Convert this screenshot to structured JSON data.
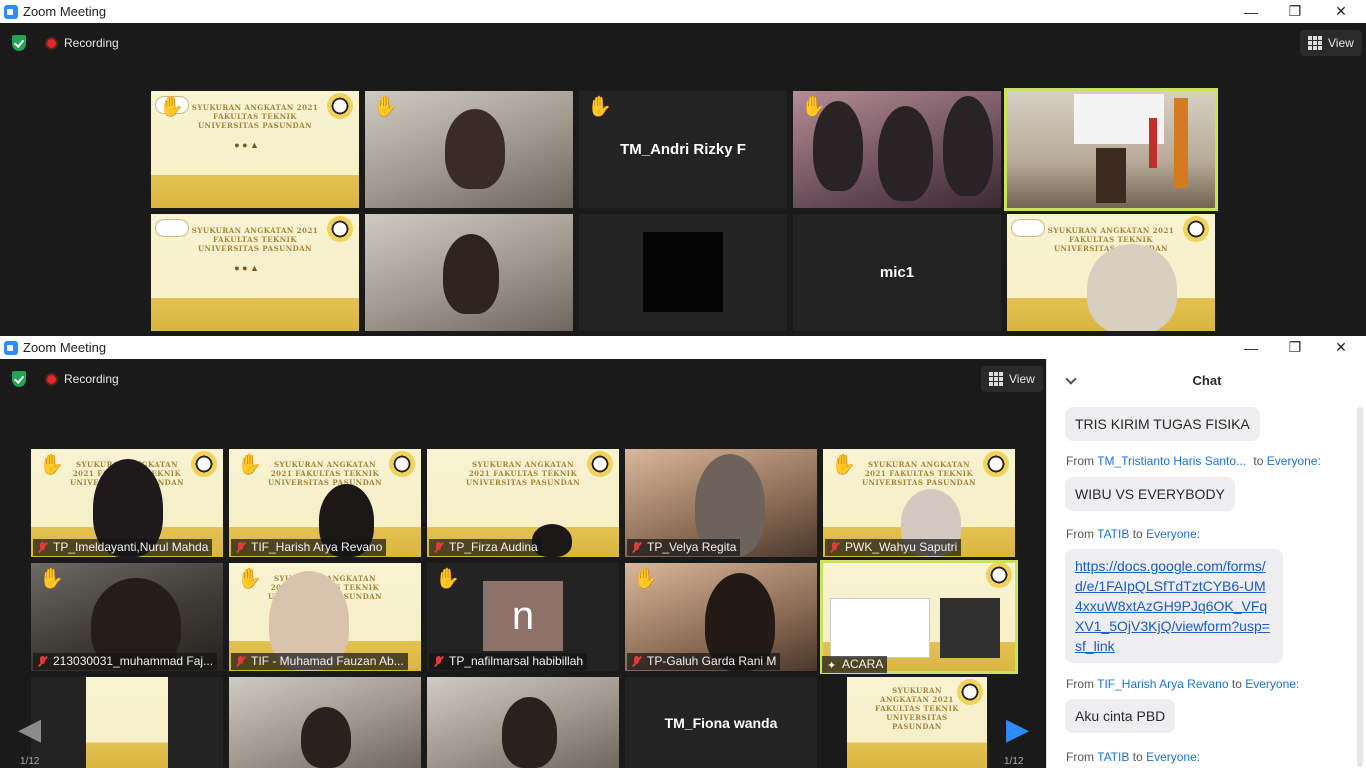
{
  "window1": {
    "title": "Zoom Meeting",
    "recording": "Recording",
    "view_label": "View",
    "controls": [
      "—",
      "❐",
      "✕"
    ],
    "tiles": [
      {
        "name": "",
        "hand": true
      },
      {
        "name": "",
        "hand": true
      },
      {
        "name": "TM_Andri Rizky F",
        "hand": true
      },
      {
        "name": "",
        "hand": true
      },
      {
        "name": "",
        "hand": false
      },
      {
        "name": "",
        "hand": false
      },
      {
        "name": "",
        "hand": false
      },
      {
        "name": "",
        "hand": false
      },
      {
        "name": "mic1",
        "hand": false
      },
      {
        "name": "",
        "hand": false
      }
    ]
  },
  "window2": {
    "title": "Zoom Meeting",
    "recording": "Recording",
    "view_label": "View",
    "controls": [
      "—",
      "❐",
      "✕"
    ],
    "banner_text": "SYUKURAN ANGKATAN 2021 FAKULTAS TEKNIK UNIVERSITAS PASUNDAN",
    "tiles": [
      {
        "label": "TP_Imeldayanti,Nurul Mahda",
        "muted": true,
        "hand": true
      },
      {
        "label": "TIF_Harish Arya Revano",
        "muted": true,
        "hand": true
      },
      {
        "label": "TP_Firza Audina",
        "muted": true,
        "hand": false
      },
      {
        "label": "TP_Velya Regita",
        "muted": true,
        "hand": false
      },
      {
        "label": "PWK_Wahyu Saputri",
        "muted": true,
        "hand": true
      },
      {
        "label": "213030031_muhammad Faj...",
        "muted": true,
        "hand": true
      },
      {
        "label": "TIF - Muhamad Fauzan Ab...",
        "muted": true,
        "hand": true
      },
      {
        "label": "TP_nafilmarsal habibillah",
        "muted": true,
        "hand": true
      },
      {
        "label": "TP-Galuh Garda Rani M",
        "muted": true,
        "hand": true
      },
      {
        "label": "ACARA",
        "muted": false,
        "hand": false
      },
      {
        "label": "",
        "muted": false,
        "hand": false
      },
      {
        "label": "",
        "muted": false,
        "hand": false
      },
      {
        "label": "",
        "muted": false,
        "hand": false
      },
      {
        "label": "TM_Fiona wanda",
        "muted": false,
        "hand": false
      },
      {
        "label": "",
        "muted": false,
        "hand": false
      }
    ],
    "initial_letter": "n",
    "pager_left": "1/12",
    "pager_right": "1/12"
  },
  "chat": {
    "title": "Chat",
    "messages": [
      {
        "from": "",
        "to": "",
        "text": "TRIS KIRIM TUGAS FISIKA",
        "link": false
      },
      {
        "from": "TM_Tristianto Haris Santo...",
        "to": "Everyone:",
        "text": "WIBU VS EVERYBODY",
        "link": false
      },
      {
        "from": "TATIB",
        "to": "Everyone:",
        "text": "https://docs.google.com/forms/d/e/1FAIpQLSfTdTztCYB6-UM4xxuW8xtAzGH9PJq6OK_VFqXV1_5OjV3KjQ/viewform?usp=sf_link",
        "link": true
      },
      {
        "from": "TIF_Harish Arya Revano",
        "to": "Everyone:",
        "text": "Aku cinta PBD",
        "link": false
      },
      {
        "from": "TATIB",
        "to": "Everyone:",
        "text": "",
        "link": false
      }
    ],
    "from_word": "From",
    "to_word": "to"
  },
  "colors": {
    "accent": "#2d8cff",
    "active_speaker": "#c9e35c",
    "record": "#e02828",
    "link": "#1a73d9",
    "nav_arrow": "#2d8cff"
  }
}
